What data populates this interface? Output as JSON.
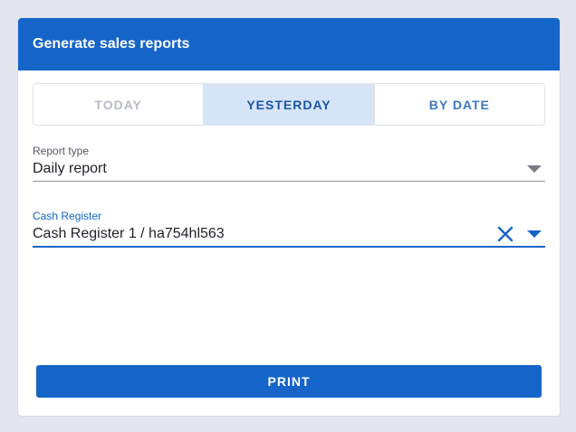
{
  "header": {
    "title": "Generate sales reports"
  },
  "tabs": [
    {
      "label": "TODAY",
      "state": "disabled"
    },
    {
      "label": "YESTERDAY",
      "state": "selected"
    },
    {
      "label": "BY DATE",
      "state": "normal"
    }
  ],
  "report_type": {
    "label": "Report type",
    "value": "Daily report"
  },
  "cash_register": {
    "label": "Cash Register",
    "value": "Cash Register 1 / ha754hl563"
  },
  "actions": {
    "print_label": "PRINT"
  },
  "colors": {
    "accent": "#1565c8",
    "selected_tab_bg": "#d6e4f8",
    "background": "#e3e6ef"
  },
  "icons": {
    "clear": "close-icon",
    "dropdown": "chevron-down-icon"
  }
}
